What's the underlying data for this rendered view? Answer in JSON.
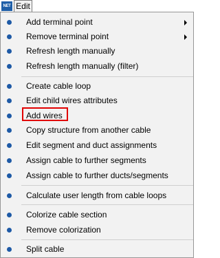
{
  "menubar": {
    "app_icon_text": "NET",
    "menu_title": "Edit"
  },
  "menu": {
    "accent_color": "#1e5aa6",
    "highlight_color": "#e10000",
    "items": [
      {
        "label": "Add terminal point",
        "has_submenu": true
      },
      {
        "label": "Remove terminal point",
        "has_submenu": true
      },
      {
        "label": "Refresh length manually",
        "has_submenu": false
      },
      {
        "label": "Refresh length manually (filter)",
        "has_submenu": false
      },
      {
        "label": "Create cable loop",
        "has_submenu": false
      },
      {
        "label": "Edit child wires attributes",
        "has_submenu": false
      },
      {
        "label": "Add wires",
        "has_submenu": false,
        "highlighted": true
      },
      {
        "label": "Copy structure from another cable",
        "has_submenu": false
      },
      {
        "label": "Edit segment and duct assignments",
        "has_submenu": false
      },
      {
        "label": "Assign cable to further segments",
        "has_submenu": false
      },
      {
        "label": "Assign cable to further ducts/segments",
        "has_submenu": false
      },
      {
        "label": "Calculate user length from cable loops",
        "has_submenu": false
      },
      {
        "label": "Colorize cable section",
        "has_submenu": false
      },
      {
        "label": "Remove colorization",
        "has_submenu": false
      },
      {
        "label": "Split cable",
        "has_submenu": false
      }
    ]
  }
}
